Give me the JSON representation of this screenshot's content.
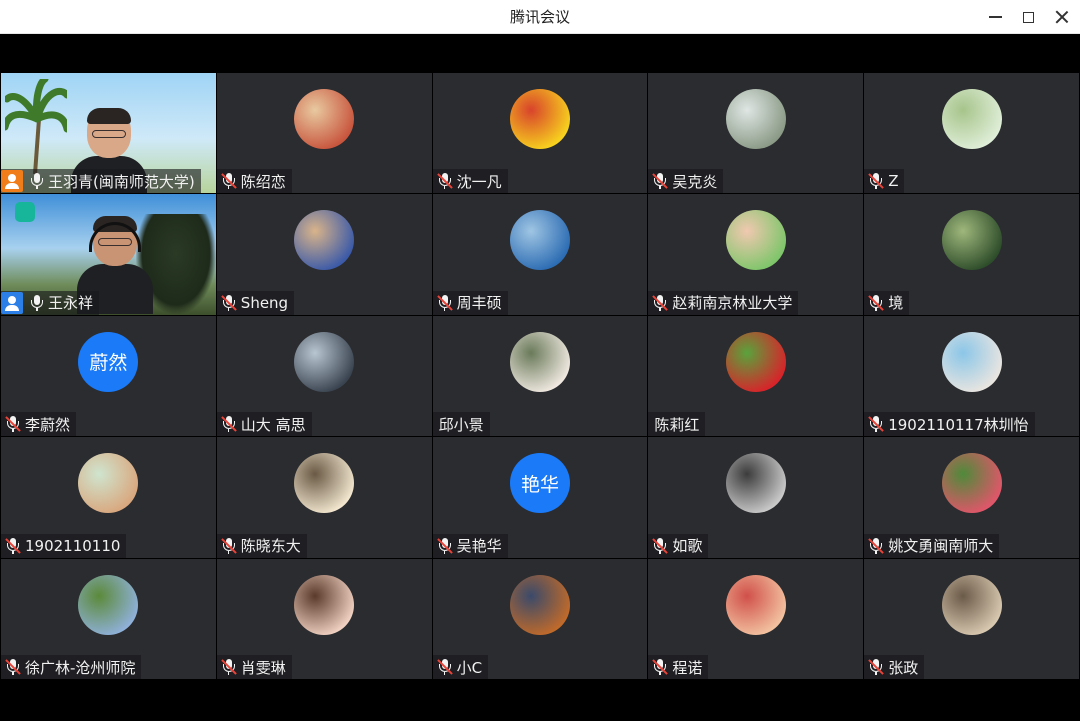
{
  "window": {
    "title": "腾讯会议",
    "controls": [
      "minimize-icon",
      "maximize-icon",
      "close-icon"
    ]
  },
  "participants": [
    {
      "name": "王羽青(闽南师范大学)",
      "mic": "on",
      "badge": "host",
      "type": "video"
    },
    {
      "name": "陈绍恋",
      "mic": "off",
      "avatar_colors": [
        "#c8553d",
        "#e8c9a0"
      ]
    },
    {
      "name": "沈一凡",
      "mic": "off",
      "avatar_colors": [
        "#f7d21e",
        "#d8432b"
      ]
    },
    {
      "name": "吴克炎",
      "mic": "off",
      "avatar_colors": [
        "#8a9a86",
        "#dfe6e4"
      ]
    },
    {
      "name": "Z",
      "mic": "off",
      "avatar_colors": [
        "#dfeed8",
        "#a7c48b"
      ]
    },
    {
      "name": "王永祥",
      "mic": "on",
      "badge": "cohost",
      "type": "video"
    },
    {
      "name": "Sheng",
      "mic": "off",
      "avatar_colors": [
        "#3b5aa8",
        "#d9b48a"
      ]
    },
    {
      "name": "周丰硕",
      "mic": "off",
      "avatar_colors": [
        "#2c6cb3",
        "#9fc5e3"
      ]
    },
    {
      "name": "赵莉南京林业大学",
      "mic": "off",
      "avatar_colors": [
        "#7ec66a",
        "#f0c8b0"
      ]
    },
    {
      "name": "境",
      "mic": "off",
      "avatar_colors": [
        "#2e4d2a",
        "#9fb77c"
      ]
    },
    {
      "name": "李蔚然",
      "mic": "off",
      "avatar_text": "蔚然",
      "avatar_colors": [
        "#1a7af8",
        "#1a7af8"
      ]
    },
    {
      "name": "山大 高思",
      "mic": "off",
      "avatar_colors": [
        "#3a4450",
        "#b8c6d2"
      ]
    },
    {
      "name": "邱小景",
      "mic": "none",
      "avatar_colors": [
        "#efe8e0",
        "#6a7a5a"
      ]
    },
    {
      "name": "陈莉红",
      "mic": "none",
      "avatar_colors": [
        "#d8232a",
        "#5aa33c"
      ]
    },
    {
      "name": "1902110117林圳怡",
      "mic": "off",
      "avatar_colors": [
        "#e9e5e0",
        "#8bc6e8"
      ]
    },
    {
      "name": "1902110110",
      "mic": "off",
      "avatar_colors": [
        "#d9a77e",
        "#cfe5cf"
      ]
    },
    {
      "name": "陈晓东大",
      "mic": "off",
      "avatar_colors": [
        "#f2e6cf",
        "#6a5a45"
      ]
    },
    {
      "name": "吴艳华",
      "mic": "off",
      "avatar_text": "艳华",
      "avatar_colors": [
        "#1a7af8",
        "#1a7af8"
      ]
    },
    {
      "name": "如歌",
      "mic": "off",
      "avatar_colors": [
        "#c9c9c9",
        "#3c3c3c"
      ]
    },
    {
      "name": "姚文勇闽南师大",
      "mic": "off",
      "avatar_colors": [
        "#e0566a",
        "#4f8a3a"
      ]
    },
    {
      "name": "徐广林-沧州师院",
      "mic": "off",
      "avatar_colors": [
        "#8fb0d8",
        "#5c8a3a"
      ]
    },
    {
      "name": "肖雯琳",
      "mic": "off",
      "avatar_colors": [
        "#f0d0c0",
        "#5a3a2a"
      ]
    },
    {
      "name": "小C",
      "mic": "off",
      "avatar_colors": [
        "#c06a2a",
        "#3a4a6a"
      ]
    },
    {
      "name": "程诺",
      "mic": "off",
      "avatar_colors": [
        "#f2c2a0",
        "#d0504a"
      ]
    },
    {
      "name": "张政",
      "mic": "off",
      "avatar_colors": [
        "#d8c8b0",
        "#6a5a48"
      ]
    }
  ]
}
